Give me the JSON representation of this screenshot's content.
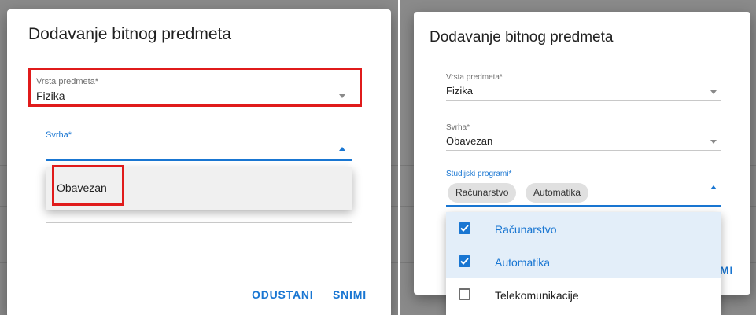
{
  "left": {
    "dialog": {
      "title": "Dodavanje bitnog predmeta",
      "vrsta": {
        "label": "Vrsta predmeta*",
        "value": "Fizika"
      },
      "svrha": {
        "label": "Svrha*",
        "value": ""
      },
      "dropdown": {
        "options": [
          "Obavezan"
        ]
      },
      "buttons": {
        "cancel": "ODUSTANI",
        "save": "SNIMI"
      }
    }
  },
  "right": {
    "dialog": {
      "title": "Dodavanje bitnog predmeta",
      "vrsta": {
        "label": "Vrsta predmeta*",
        "value": "Fizika"
      },
      "svrha": {
        "label": "Svrha*",
        "value": "Obavezan"
      },
      "programi": {
        "label": "Studijski programi*",
        "chips": [
          "Računarstvo",
          "Automatika"
        ]
      },
      "dropdown": {
        "options": [
          {
            "label": "Računarstvo",
            "checked": true
          },
          {
            "label": "Automatika",
            "checked": true
          },
          {
            "label": "Telekomunikacije",
            "checked": false
          }
        ]
      },
      "buttons": {
        "save_partial": "MI"
      }
    }
  },
  "colors": {
    "accent": "#1976d2",
    "highlight": "#e01b1b",
    "overlay": "#8a8a8a"
  }
}
